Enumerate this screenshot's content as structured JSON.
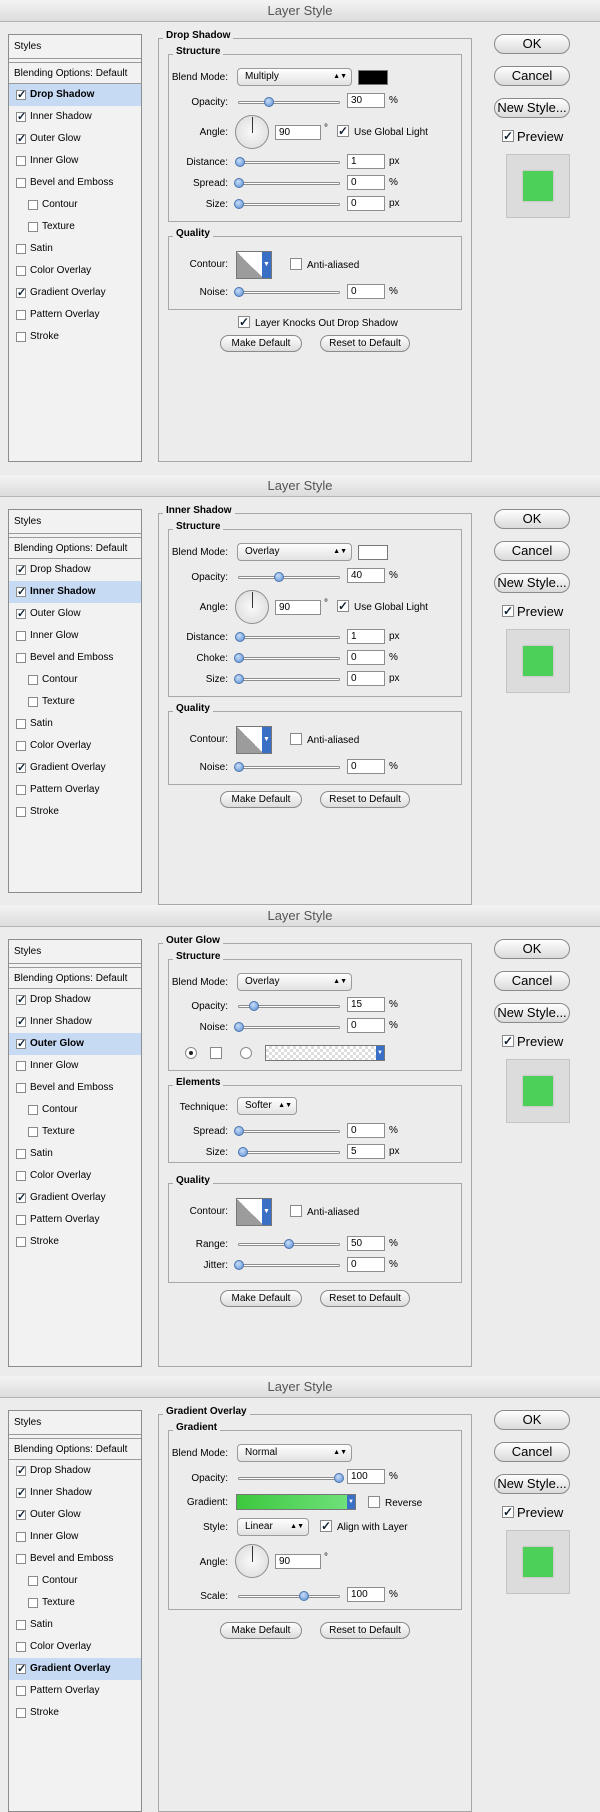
{
  "window": {
    "title": "Layer Style"
  },
  "sidebar": {
    "styles_label": "Styles",
    "blending_options": "Blending Options: Default",
    "items": [
      "Drop Shadow",
      "Inner Shadow",
      "Outer Glow",
      "Inner Glow",
      "Bevel and Emboss",
      "Contour",
      "Texture",
      "Satin",
      "Color Overlay",
      "Gradient Overlay",
      "Pattern Overlay",
      "Stroke"
    ]
  },
  "buttons": {
    "ok": "OK",
    "cancel": "Cancel",
    "new_style": "New Style...",
    "preview": "Preview",
    "make_default": "Make Default",
    "reset_default": "Reset to Default"
  },
  "common": {
    "structure": "Structure",
    "quality": "Quality",
    "blend_mode": "Blend Mode:",
    "opacity": "Opacity:",
    "angle": "Angle:",
    "use_global_light": "Use Global Light",
    "distance": "Distance:",
    "spread": "Spread:",
    "size": "Size:",
    "choke": "Choke:",
    "contour": "Contour:",
    "anti_aliased": "Anti-aliased",
    "noise": "Noise:",
    "percent": "%",
    "px": "px",
    "degree": "°"
  },
  "panels": {
    "drop_shadow": {
      "heading": "Drop Shadow",
      "blend_mode": "Multiply",
      "opacity": "30",
      "angle": "90",
      "distance": "1",
      "spread": "0",
      "size": "0",
      "noise": "0",
      "knockout": "Layer Knocks Out Drop Shadow",
      "color": "#000000"
    },
    "inner_shadow": {
      "heading": "Inner Shadow",
      "blend_mode": "Overlay",
      "opacity": "40",
      "angle": "90",
      "distance": "1",
      "choke": "0",
      "size": "0",
      "noise": "0",
      "color": "#ffffff"
    },
    "outer_glow": {
      "heading": "Outer Glow",
      "blend_mode": "Overlay",
      "opacity": "15",
      "noise": "0",
      "elements": "Elements",
      "technique_label": "Technique:",
      "technique": "Softer",
      "spread": "0",
      "size": "5",
      "range_label": "Range:",
      "range": "50",
      "jitter_label": "Jitter:",
      "jitter": "0"
    },
    "gradient_overlay": {
      "heading": "Gradient Overlay",
      "gradient_group": "Gradient",
      "blend_mode": "Normal",
      "opacity": "100",
      "gradient_label": "Gradient:",
      "reverse": "Reverse",
      "style_label": "Style:",
      "style": "Linear",
      "align_with_layer": "Align with Layer",
      "angle": "90",
      "scale_label": "Scale:",
      "scale": "100"
    }
  },
  "colors": {
    "selection": "#c6daf4",
    "preview_fill": "#4dd05a",
    "slider_thumb": "#5b8fd4"
  }
}
